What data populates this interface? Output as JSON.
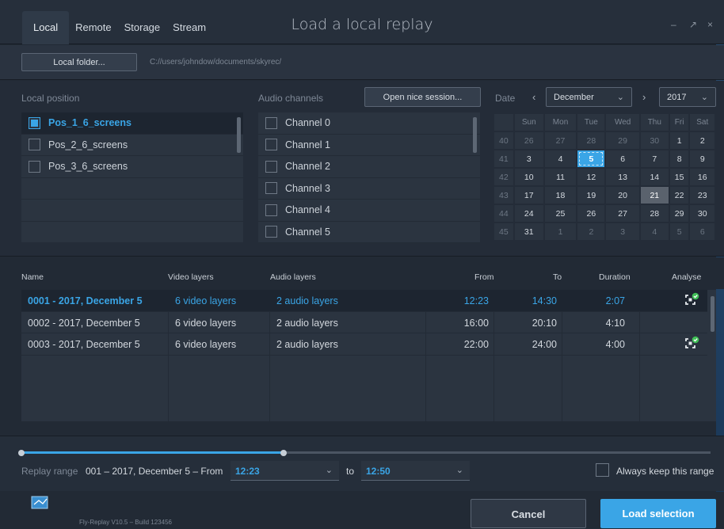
{
  "colors": {
    "accent": "#3aa5e6",
    "bg": "#222a35",
    "panel": "#2b3440",
    "today_bg": "#3aa5e6",
    "marked_day_bg": "#5a626d"
  },
  "window": {
    "title": "Load a local replay",
    "tabs": [
      "Local",
      "Remote",
      "Storage",
      "Stream"
    ],
    "active_tab": "Local",
    "controls": {
      "minimize": "–",
      "restore": "↗",
      "close": "×"
    }
  },
  "folder": {
    "button_label": "Local folder...",
    "path": "C://users/johndow/documents/skyrec/"
  },
  "local_position": {
    "label": "Local position",
    "items": [
      {
        "label": "Pos_1_6_screens",
        "checked": true
      },
      {
        "label": "Pos_2_6_screens",
        "checked": false
      },
      {
        "label": "Pos_3_6_screens",
        "checked": false
      }
    ]
  },
  "audio_channels": {
    "label": "Audio channels",
    "open_session_label": "Open nice session...",
    "items": [
      {
        "label": "Channel 0",
        "checked": false
      },
      {
        "label": "Channel 1",
        "checked": false
      },
      {
        "label": "Channel 2",
        "checked": false
      },
      {
        "label": "Channel 3",
        "checked": false
      },
      {
        "label": "Channel 4",
        "checked": false
      },
      {
        "label": "Channel 5",
        "checked": false
      }
    ]
  },
  "date": {
    "label": "Date",
    "prev_icon": "‹",
    "next_icon": "›",
    "month": "December",
    "year": "2017",
    "weekdays": [
      "Sun",
      "Mon",
      "Tue",
      "Wed",
      "Thu",
      "Fri",
      "Sat"
    ],
    "weeks": [
      {
        "wk": "40",
        "days": [
          "26",
          "27",
          "28",
          "29",
          "30",
          "1",
          "2"
        ],
        "dim": [
          true,
          true,
          true,
          true,
          true,
          false,
          false
        ]
      },
      {
        "wk": "41",
        "days": [
          "3",
          "4",
          "5",
          "6",
          "7",
          "8",
          "9"
        ],
        "dim": [
          false,
          false,
          false,
          false,
          false,
          false,
          false
        ]
      },
      {
        "wk": "42",
        "days": [
          "10",
          "11",
          "12",
          "13",
          "14",
          "15",
          "16"
        ],
        "dim": [
          false,
          false,
          false,
          false,
          false,
          false,
          false
        ]
      },
      {
        "wk": "43",
        "days": [
          "17",
          "18",
          "19",
          "20",
          "21",
          "22",
          "23"
        ],
        "dim": [
          false,
          false,
          false,
          false,
          false,
          false,
          false
        ]
      },
      {
        "wk": "44",
        "days": [
          "24",
          "25",
          "26",
          "27",
          "28",
          "29",
          "30"
        ],
        "dim": [
          false,
          false,
          false,
          false,
          false,
          false,
          false
        ]
      },
      {
        "wk": "45",
        "days": [
          "31",
          "1",
          "2",
          "3",
          "4",
          "5",
          "6"
        ],
        "dim": [
          false,
          true,
          true,
          true,
          true,
          true,
          true
        ]
      }
    ],
    "selected_day": "5",
    "marked_day": "21"
  },
  "table": {
    "headers": {
      "name": "Name",
      "video": "Video layers",
      "audio": "Audio layers",
      "from": "From",
      "to": "To",
      "duration": "Duration",
      "analyse": "Analyse"
    },
    "rows": [
      {
        "name": "0001 - 2017, December 5",
        "video": "6 video layers",
        "audio": "2 audio layers",
        "from": "12:23",
        "to": "14:30",
        "duration": "2:07",
        "analysed": true,
        "selected": true
      },
      {
        "name": "0002 - 2017, December 5",
        "video": "6 video layers",
        "audio": "2 audio layers",
        "from": "16:00",
        "to": "20:10",
        "duration": "4:10",
        "analysed": false,
        "selected": false
      },
      {
        "name": "0003 - 2017, December 5",
        "video": "6 video layers",
        "audio": "2 audio layers",
        "from": "22:00",
        "to": "24:00",
        "duration": "4:00",
        "analysed": true,
        "selected": false
      }
    ]
  },
  "range": {
    "label": "Replay range",
    "description": "001 – 2017, December 5 – From",
    "from_value": "12:23",
    "to_label": "to",
    "to_value": "12:50",
    "keep_label": "Always keep this range",
    "slider_fraction": 0.38
  },
  "footer": {
    "build": "Fly-Replay V10.5 – Build 123456",
    "cancel_label": "Cancel",
    "load_label": "Load selection"
  }
}
